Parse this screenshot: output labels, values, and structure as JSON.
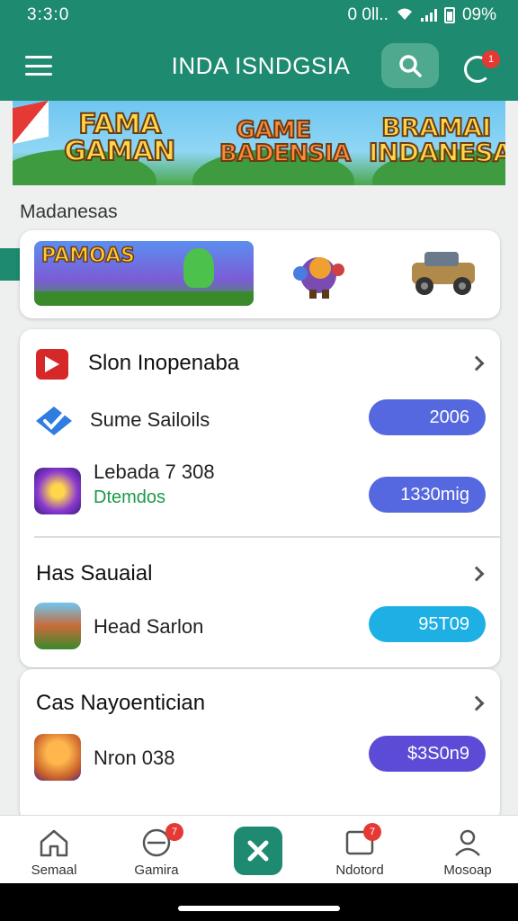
{
  "status_bar": {
    "time": "3:3:0",
    "icons_text": "0 0ll..",
    "battery": "09%"
  },
  "header": {
    "title": "INDA ISNDGSIA",
    "notification_count": "1"
  },
  "banner": {
    "items": [
      "FAMA GAMAN",
      "GAME BADENSIA",
      "BRAMAI INDANESA"
    ]
  },
  "section": {
    "label": "Madanesas"
  },
  "featured": {
    "title": "PAMOAS"
  },
  "group1": {
    "title": "Slon Inopenaba",
    "items": [
      {
        "label": "Sume Sailoils",
        "pill": "2006",
        "pill_color": "#5568e0"
      },
      {
        "label": "Lebada 7 308",
        "sub": "Dtemdos",
        "pill": "1330mig",
        "pill_color": "#5568e0"
      }
    ],
    "sub_title": "Has Sauaial",
    "sub_items": [
      {
        "label": "Head Sarlon",
        "pill": "95T09",
        "pill_color": "#1eb0e4"
      }
    ]
  },
  "group2": {
    "title": "Cas Nayoentician",
    "items": [
      {
        "label": "Nron 038",
        "pill": "$3S0n9",
        "pill_color": "#5c4bd6"
      }
    ]
  },
  "bottom_nav": {
    "items": [
      {
        "label": "Semaal"
      },
      {
        "label": "Gamira",
        "badge": "7"
      },
      {
        "label": ""
      },
      {
        "label": "Ndotord",
        "badge": "7"
      },
      {
        "label": "Mosoap"
      }
    ]
  },
  "colors": {
    "brand": "#1e8a6f",
    "pill_blue": "#5568e0",
    "pill_cyan": "#1eb0e4",
    "badge_red": "#e53935"
  }
}
